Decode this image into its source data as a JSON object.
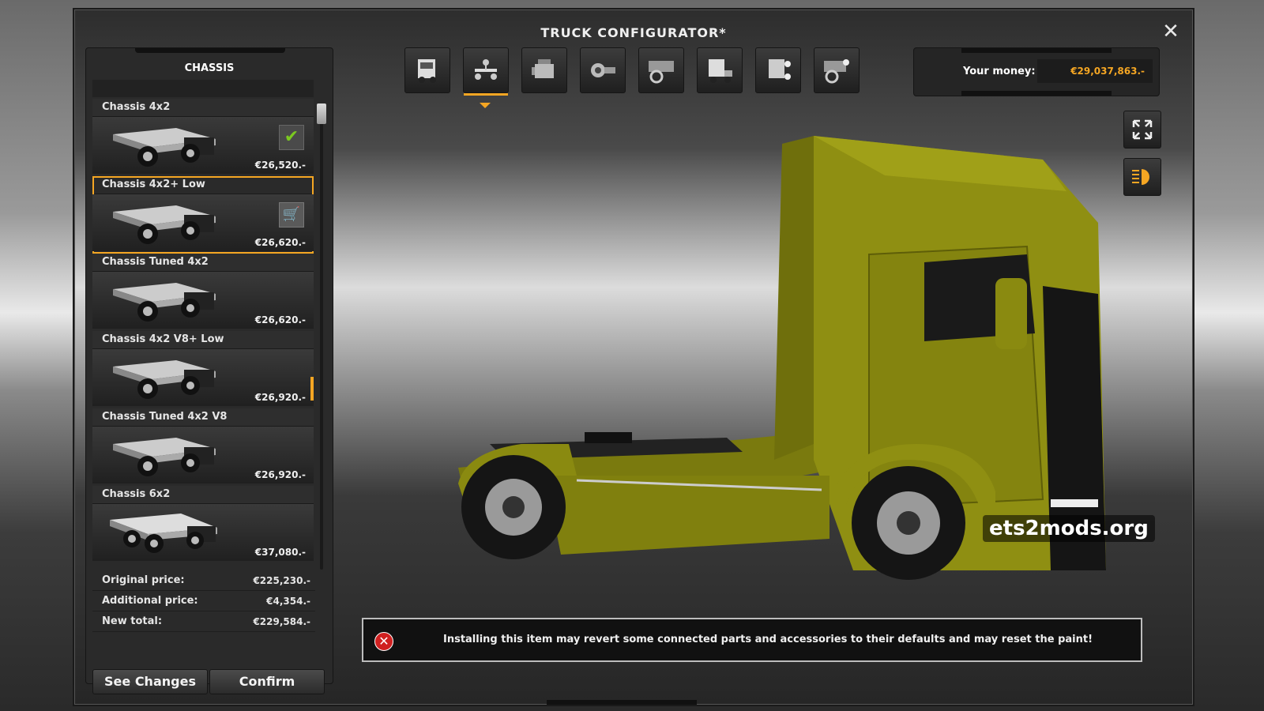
{
  "window": {
    "title": "TRUCK CONFIGURATOR*"
  },
  "panel": {
    "header": "CHASSIS",
    "items": [
      {
        "name": "Chassis 4x2",
        "price": "€26,520.-",
        "state": "owned"
      },
      {
        "name": "Chassis 4x2+ Low",
        "price": "€26,620.-",
        "state": "selected"
      },
      {
        "name": "Chassis Tuned 4x2",
        "price": "€26,620.-",
        "state": "normal"
      },
      {
        "name": "Chassis 4x2 V8+ Low",
        "price": "€26,920.-",
        "state": "hover"
      },
      {
        "name": "Chassis Tuned 4x2 V8",
        "price": "€26,920.-",
        "state": "normal"
      },
      {
        "name": "Chassis 6x2",
        "price": "€37,080.-",
        "state": "normal"
      }
    ],
    "summary": {
      "original_label": "Original price:",
      "original_value": "€225,230.-",
      "additional_label": "Additional price:",
      "additional_value": "€4,354.-",
      "total_label": "New total:",
      "total_value": "€229,584.-"
    },
    "see_changes": "See Changes",
    "confirm": "Confirm"
  },
  "toolbar": {
    "icons": [
      "cabin-icon",
      "chassis-icon",
      "engine-icon",
      "transmission-icon",
      "interior-icon",
      "trailer-icon",
      "lights-icon",
      "accessories-icon"
    ],
    "active_index": 1
  },
  "money": {
    "label": "Your money:",
    "value": "€29,037,863.-"
  },
  "watermark": "ets2mods.org",
  "warning": {
    "text": "Installing this item may revert some connected parts and accessories to their defaults and may reset the paint!"
  },
  "colors": {
    "accent": "#f5a623",
    "truck_paint": "#8a8a10",
    "check": "#7bc920",
    "error": "#d02020"
  }
}
